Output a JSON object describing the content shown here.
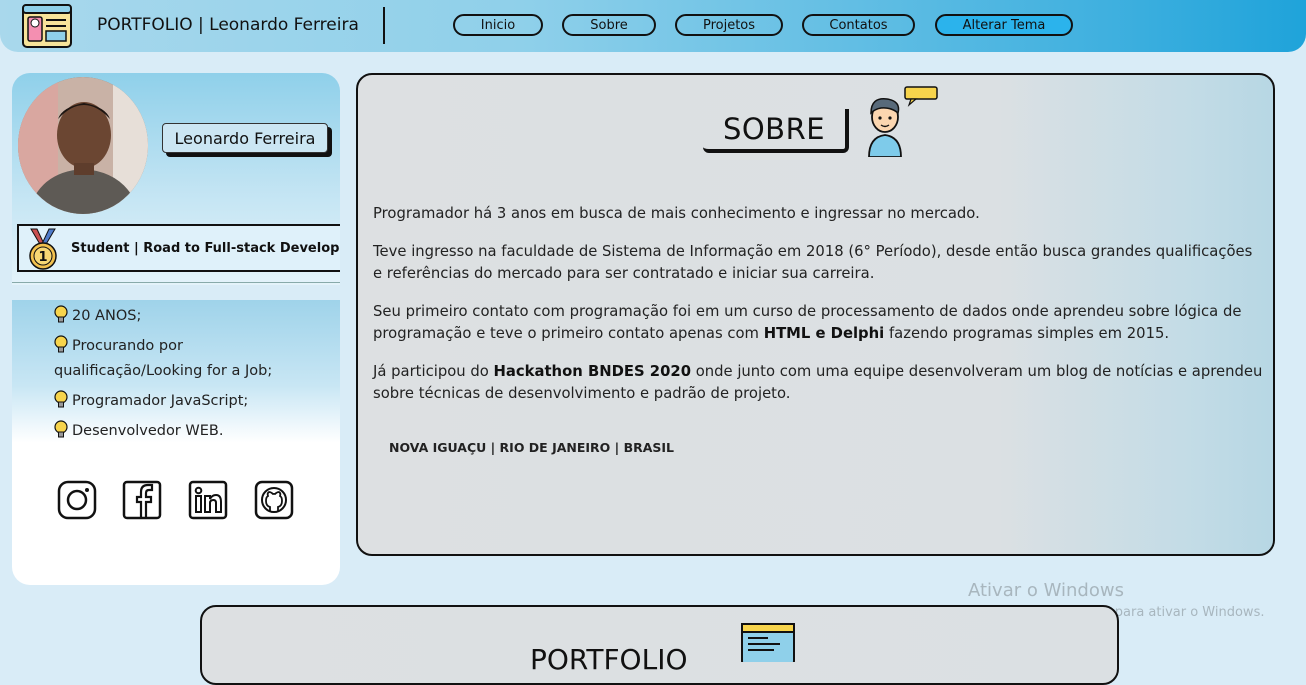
{
  "header": {
    "title": "PORTFOLIO | Leonardo Ferreira",
    "nav": [
      "Inicio",
      "Sobre",
      "Projetos",
      "Contatos",
      "Alterar Tema"
    ],
    "accent": "#2bb3ec"
  },
  "profile": {
    "name": "Leonardo Ferreira",
    "badge": "Student | Road to Full-stack Developer",
    "info": [
      "20 ANOS;",
      "Procurando por qualificação/Looking for a Job;",
      "Programador JavaScript;",
      "Desenvolvedor WEB."
    ],
    "social": [
      "instagram-icon",
      "facebook-icon",
      "linkedin-icon",
      "github-icon"
    ]
  },
  "about": {
    "title": "SOBRE",
    "p1": "Programador há 3 anos em busca de mais conhecimento e ingressar no mercado.",
    "p2": "Teve ingresso na faculdade de Sistema de Informação em 2018 (6° Período), desde então busca grandes qualificações e referências do mercado para ser contratado e iniciar sua carreira.",
    "p3_a": "Seu primeiro contato com programação foi em um curso de processamento de dados onde aprendeu sobre lógica de programação e teve o primeiro contato apenas com ",
    "p3_b": "HTML e Delphi",
    "p3_c": " fazendo programas simples em 2015.",
    "p4_a": "Já participou do ",
    "p4_b": "Hackathon BNDES 2020",
    "p4_c": " onde junto com uma equipe desenvolveram um blog de notícias e aprendeu sobre técnicas de desenvolvimento e padrão de projeto.",
    "location": "NOVA IGUAÇU | RIO DE JANEIRO | BRASIL"
  },
  "portfolio": {
    "title": "PORTFOLIO"
  },
  "watermark": {
    "title": "Ativar o Windows",
    "subtitle": "Acesse Configurações para ativar o Windows."
  }
}
